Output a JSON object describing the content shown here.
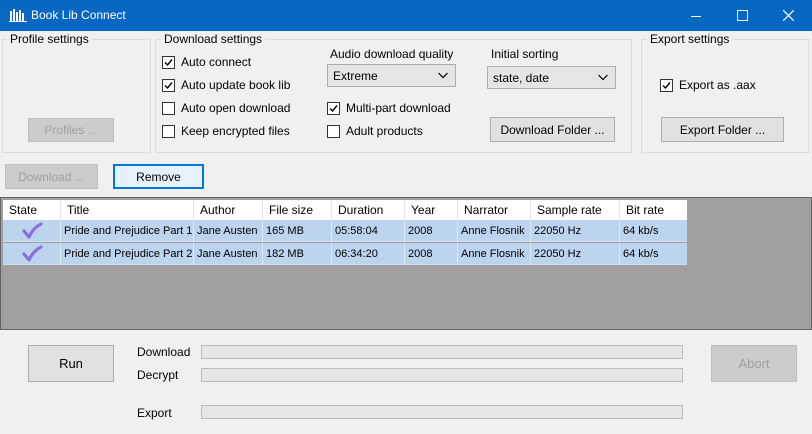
{
  "window": {
    "title": "Book Lib Connect"
  },
  "profile_settings": {
    "title": "Profile settings",
    "profiles_button": "Profiles ..."
  },
  "download_settings": {
    "title": "Download settings",
    "checks": [
      {
        "label": "Auto connect",
        "checked": true
      },
      {
        "label": "Auto update book lib",
        "checked": true
      },
      {
        "label": "Auto open download",
        "checked": false
      },
      {
        "label": "Keep encrypted files",
        "checked": false
      }
    ],
    "quality_label": "Audio download quality",
    "quality_value": "Extreme",
    "sorting_label": "Initial sorting",
    "sorting_value": "state, date",
    "multipart": {
      "label": "Multi-part download",
      "checked": true
    },
    "adult": {
      "label": "Adult products",
      "checked": false
    },
    "download_folder_button": "Download Folder ..."
  },
  "export_settings": {
    "title": "Export settings",
    "export_aax": {
      "label": "Export as .aax",
      "checked": true
    },
    "export_folder_button": "Export Folder ..."
  },
  "actions": {
    "download_button": "Download ...",
    "remove_button": "Remove"
  },
  "table": {
    "columns": [
      "State",
      "Title",
      "Author",
      "File size",
      "Duration",
      "Year",
      "Narrator",
      "Sample rate",
      "Bit rate"
    ],
    "rows": [
      {
        "state": "check-icon",
        "title": "Pride and Prejudice Part 1",
        "author": "Jane Austen",
        "file_size": "165 MB",
        "duration": "05:58:04",
        "year": "2008",
        "narrator": "Anne Flosnik",
        "sample_rate": "22050 Hz",
        "bit_rate": "64 kb/s"
      },
      {
        "state": "check-icon",
        "title": "Pride and Prejudice Part 2",
        "author": "Jane Austen",
        "file_size": "182 MB",
        "duration": "06:34:20",
        "year": "2008",
        "narrator": "Anne Flosnik",
        "sample_rate": "22050 Hz",
        "bit_rate": "64 kb/s"
      }
    ]
  },
  "bottom": {
    "run_button": "Run",
    "abort_button": "Abort",
    "download_label": "Download",
    "decrypt_label": "Decrypt",
    "export_label": "Export",
    "download_progress": 0,
    "decrypt_progress": 0,
    "export_progress": 0
  },
  "colors": {
    "titlebar": "#0767c2",
    "row_selected": "#bdd4ee",
    "check": "#8a6fdc",
    "table_bg": "#a0a0a0"
  }
}
